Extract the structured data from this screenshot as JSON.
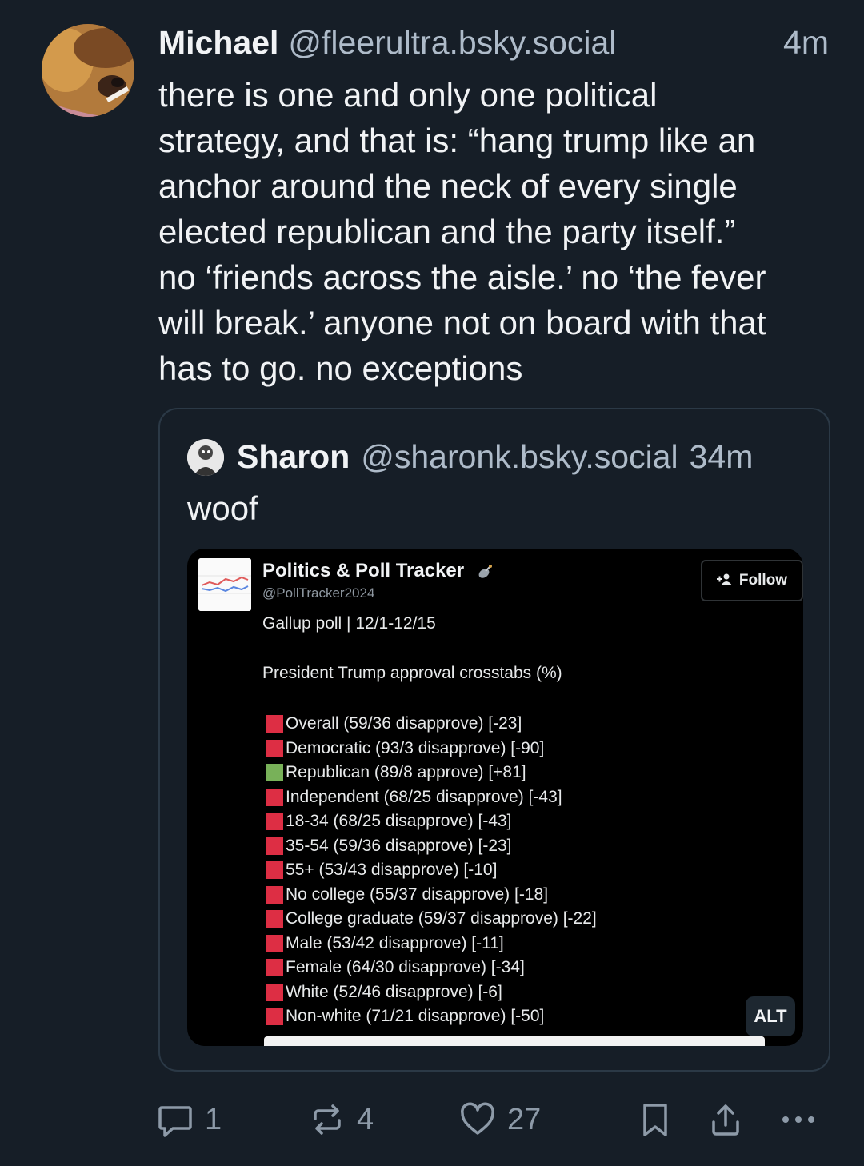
{
  "post": {
    "author_name": "Michael",
    "author_handle": "@fleerultra.bsky.social",
    "time": "4m",
    "text_lines": [
      "there is one and only one political",
      "strategy, and that is: “hang trump like an",
      "anchor around the neck of every single",
      "elected republican and the party itself.”",
      "no ‘friends across the aisle.’ no ‘the fever",
      "will break.’ anyone not on board with that",
      "has to go. no exceptions"
    ]
  },
  "quote": {
    "author_name": "Sharon",
    "author_handle": "@sharonk.bsky.social",
    "time": "34m",
    "text": "woof",
    "embed": {
      "account_name": "Politics & Poll Tracker",
      "account_handle": "@PollTracker2024",
      "follow_label": "Follow",
      "line1": "Gallup poll | 12/1-12/15",
      "line2": "President Trump approval crosstabs (%)",
      "rows": [
        {
          "color": "red",
          "text": "Overall (59/36 disapprove) [-23]"
        },
        {
          "color": "red",
          "text": "Democratic (93/3 disapprove) [-90]"
        },
        {
          "color": "green",
          "text": "Republican (89/8 approve) [+81]"
        },
        {
          "color": "red",
          "text": "Independent (68/25 disapprove) [-43]"
        },
        {
          "color": "red",
          "text": "18-34 (68/25 disapprove) [-43]"
        },
        {
          "color": "red",
          "text": "35-54 (59/36 disapprove) [-23]"
        },
        {
          "color": "red",
          "text": "55+ (53/43 disapprove) [-10]"
        },
        {
          "color": "red",
          "text": "No college (55/37 disapprove) [-18]"
        },
        {
          "color": "red",
          "text": "College graduate (59/37 disapprove) [-22]"
        },
        {
          "color": "red",
          "text": "Male (53/42 disapprove) [-11]"
        },
        {
          "color": "red",
          "text": "Female (64/30 disapprove) [-34]"
        },
        {
          "color": "red",
          "text": "White (52/46 disapprove) [-6]"
        },
        {
          "color": "red",
          "text": "Non-white (71/21 disapprove) [-50]"
        }
      ],
      "alt_label": "ALT"
    }
  },
  "actions": {
    "reply_count": "1",
    "repost_count": "4",
    "like_count": "27"
  },
  "colors": {
    "background": "#161e27",
    "text": "#f1f3f5",
    "muted": "#aebbc9",
    "icon": "#8d9aa8",
    "border": "#2b3946",
    "red_square": "#dd2e44",
    "green_square": "#78b159"
  },
  "icons": [
    "reply-icon",
    "repost-icon",
    "like-icon",
    "bookmark-icon",
    "share-icon",
    "more-icon",
    "follow-icon"
  ]
}
